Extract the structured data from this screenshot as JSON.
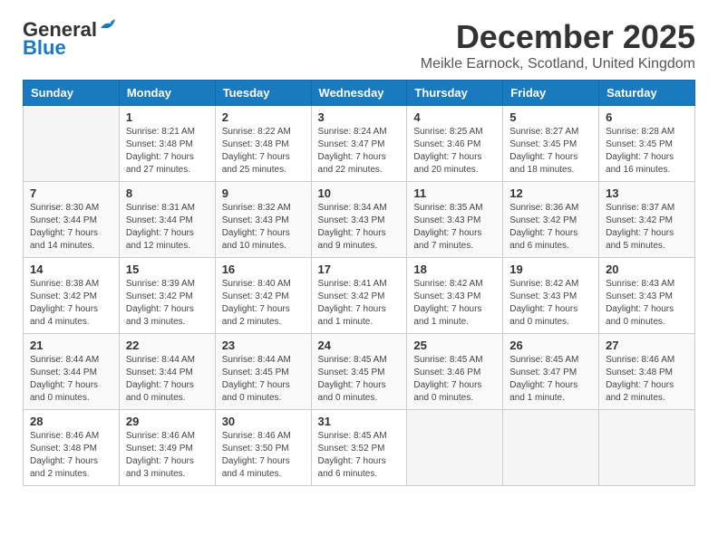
{
  "logo": {
    "line1": "General",
    "line2": "Blue"
  },
  "title": {
    "month": "December 2025",
    "location": "Meikle Earnock, Scotland, United Kingdom"
  },
  "days_of_week": [
    "Sunday",
    "Monday",
    "Tuesday",
    "Wednesday",
    "Thursday",
    "Friday",
    "Saturday"
  ],
  "weeks": [
    [
      {
        "day": "",
        "info": ""
      },
      {
        "day": "1",
        "info": "Sunrise: 8:21 AM\nSunset: 3:48 PM\nDaylight: 7 hours\nand 27 minutes."
      },
      {
        "day": "2",
        "info": "Sunrise: 8:22 AM\nSunset: 3:48 PM\nDaylight: 7 hours\nand 25 minutes."
      },
      {
        "day": "3",
        "info": "Sunrise: 8:24 AM\nSunset: 3:47 PM\nDaylight: 7 hours\nand 22 minutes."
      },
      {
        "day": "4",
        "info": "Sunrise: 8:25 AM\nSunset: 3:46 PM\nDaylight: 7 hours\nand 20 minutes."
      },
      {
        "day": "5",
        "info": "Sunrise: 8:27 AM\nSunset: 3:45 PM\nDaylight: 7 hours\nand 18 minutes."
      },
      {
        "day": "6",
        "info": "Sunrise: 8:28 AM\nSunset: 3:45 PM\nDaylight: 7 hours\nand 16 minutes."
      }
    ],
    [
      {
        "day": "7",
        "info": "Sunrise: 8:30 AM\nSunset: 3:44 PM\nDaylight: 7 hours\nand 14 minutes."
      },
      {
        "day": "8",
        "info": "Sunrise: 8:31 AM\nSunset: 3:44 PM\nDaylight: 7 hours\nand 12 minutes."
      },
      {
        "day": "9",
        "info": "Sunrise: 8:32 AM\nSunset: 3:43 PM\nDaylight: 7 hours\nand 10 minutes."
      },
      {
        "day": "10",
        "info": "Sunrise: 8:34 AM\nSunset: 3:43 PM\nDaylight: 7 hours\nand 9 minutes."
      },
      {
        "day": "11",
        "info": "Sunrise: 8:35 AM\nSunset: 3:43 PM\nDaylight: 7 hours\nand 7 minutes."
      },
      {
        "day": "12",
        "info": "Sunrise: 8:36 AM\nSunset: 3:42 PM\nDaylight: 7 hours\nand 6 minutes."
      },
      {
        "day": "13",
        "info": "Sunrise: 8:37 AM\nSunset: 3:42 PM\nDaylight: 7 hours\nand 5 minutes."
      }
    ],
    [
      {
        "day": "14",
        "info": "Sunrise: 8:38 AM\nSunset: 3:42 PM\nDaylight: 7 hours\nand 4 minutes."
      },
      {
        "day": "15",
        "info": "Sunrise: 8:39 AM\nSunset: 3:42 PM\nDaylight: 7 hours\nand 3 minutes."
      },
      {
        "day": "16",
        "info": "Sunrise: 8:40 AM\nSunset: 3:42 PM\nDaylight: 7 hours\nand 2 minutes."
      },
      {
        "day": "17",
        "info": "Sunrise: 8:41 AM\nSunset: 3:42 PM\nDaylight: 7 hours\nand 1 minute."
      },
      {
        "day": "18",
        "info": "Sunrise: 8:42 AM\nSunset: 3:43 PM\nDaylight: 7 hours\nand 1 minute."
      },
      {
        "day": "19",
        "info": "Sunrise: 8:42 AM\nSunset: 3:43 PM\nDaylight: 7 hours\nand 0 minutes."
      },
      {
        "day": "20",
        "info": "Sunrise: 8:43 AM\nSunset: 3:43 PM\nDaylight: 7 hours\nand 0 minutes."
      }
    ],
    [
      {
        "day": "21",
        "info": "Sunrise: 8:44 AM\nSunset: 3:44 PM\nDaylight: 7 hours\nand 0 minutes."
      },
      {
        "day": "22",
        "info": "Sunrise: 8:44 AM\nSunset: 3:44 PM\nDaylight: 7 hours\nand 0 minutes."
      },
      {
        "day": "23",
        "info": "Sunrise: 8:44 AM\nSunset: 3:45 PM\nDaylight: 7 hours\nand 0 minutes."
      },
      {
        "day": "24",
        "info": "Sunrise: 8:45 AM\nSunset: 3:45 PM\nDaylight: 7 hours\nand 0 minutes."
      },
      {
        "day": "25",
        "info": "Sunrise: 8:45 AM\nSunset: 3:46 PM\nDaylight: 7 hours\nand 0 minutes."
      },
      {
        "day": "26",
        "info": "Sunrise: 8:45 AM\nSunset: 3:47 PM\nDaylight: 7 hours\nand 1 minute."
      },
      {
        "day": "27",
        "info": "Sunrise: 8:46 AM\nSunset: 3:48 PM\nDaylight: 7 hours\nand 2 minutes."
      }
    ],
    [
      {
        "day": "28",
        "info": "Sunrise: 8:46 AM\nSunset: 3:48 PM\nDaylight: 7 hours\nand 2 minutes."
      },
      {
        "day": "29",
        "info": "Sunrise: 8:46 AM\nSunset: 3:49 PM\nDaylight: 7 hours\nand 3 minutes."
      },
      {
        "day": "30",
        "info": "Sunrise: 8:46 AM\nSunset: 3:50 PM\nDaylight: 7 hours\nand 4 minutes."
      },
      {
        "day": "31",
        "info": "Sunrise: 8:45 AM\nSunset: 3:52 PM\nDaylight: 7 hours\nand 6 minutes."
      },
      {
        "day": "",
        "info": ""
      },
      {
        "day": "",
        "info": ""
      },
      {
        "day": "",
        "info": ""
      }
    ]
  ]
}
